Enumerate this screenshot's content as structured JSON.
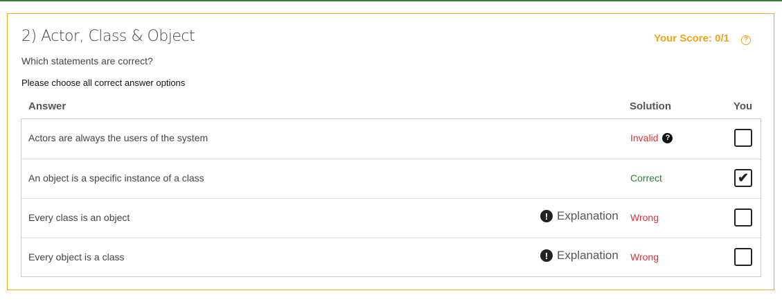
{
  "question": {
    "title": "2) Actor, Class & Object",
    "prompt": "Which statements are correct?",
    "instruction": "Please choose all correct answer options",
    "score": "Your Score: 0/1",
    "help_glyph": "?"
  },
  "columns": {
    "answer": "Answer",
    "solution": "Solution",
    "you": "You"
  },
  "rows": [
    {
      "text": "Actors are always the users of the system",
      "explanation": "",
      "solution": "Invalid",
      "solution_color": "#e0313a",
      "has_hint": true,
      "checked": false
    },
    {
      "text": "An object is a specific instance of a class",
      "explanation": "",
      "solution": "Correct",
      "solution_color": "#2e7d32",
      "has_hint": false,
      "checked": true
    },
    {
      "text": "Every class is an object",
      "explanation": "Explanation",
      "solution": "Wrong",
      "solution_color": "#e0313a",
      "has_hint": false,
      "checked": false
    },
    {
      "text": "Every object is a class",
      "explanation": "Explanation",
      "solution": "Wrong",
      "solution_color": "#e0313a",
      "has_hint": false,
      "checked": false
    }
  ],
  "colors": {
    "accent": "#f0a21e",
    "top_rule": "#2e7d32"
  }
}
